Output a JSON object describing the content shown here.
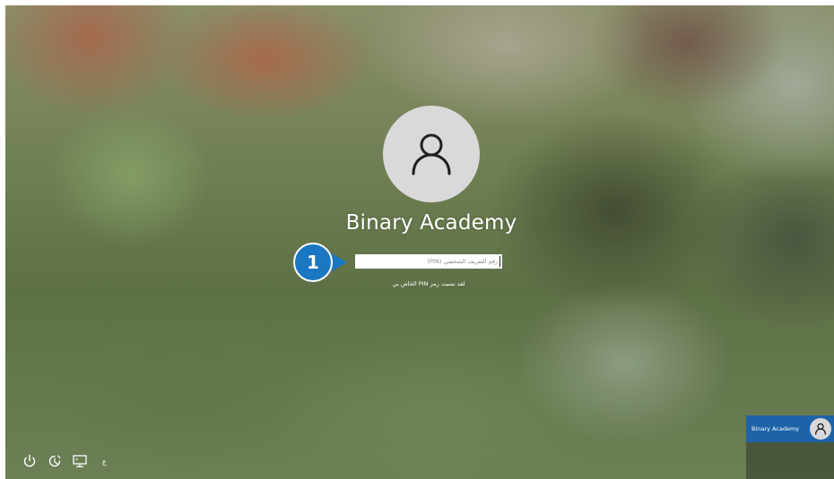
{
  "login": {
    "user_name": "Binary Academy",
    "pin_placeholder": "رقم التعريف الشخصي (PIN)",
    "pin_value": "",
    "forgot_pin_link": "لقد نسيت رمز PIN الخاص بي"
  },
  "callout": {
    "number": "1",
    "color": "#1a77c2"
  },
  "bottom_bar": {
    "icons": [
      "power-icon",
      "ease-of-access-icon",
      "network-icon"
    ],
    "language_indicator": "ع"
  },
  "user_switcher": {
    "user_name": "Binary Academy",
    "background": "#1d63a8"
  }
}
